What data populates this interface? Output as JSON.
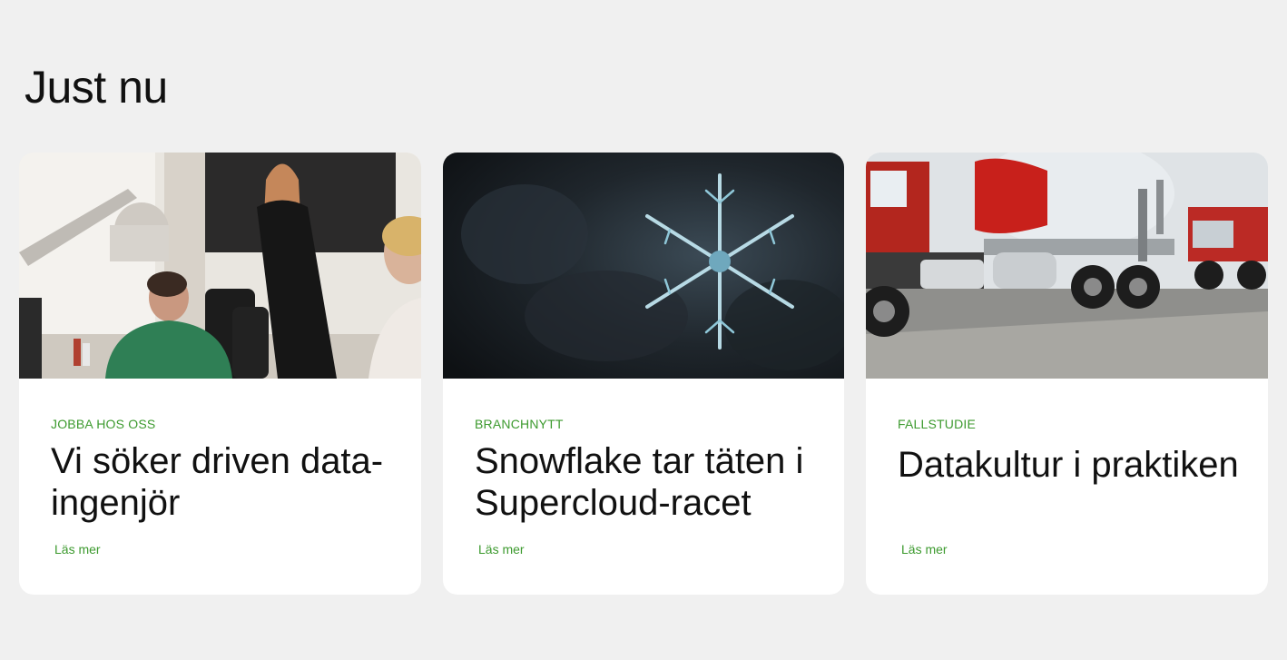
{
  "section": {
    "title": "Just nu"
  },
  "cards": [
    {
      "image": "office-meeting-photo",
      "category": "JOBBA HOS OSS",
      "title": "Vi söker driven data-ingenjör",
      "link_label": "Läs mer"
    },
    {
      "image": "snowflake-photo",
      "category": "BRANCHNYTT",
      "title": "Snowflake tar täten i Supercloud-racet",
      "link_label": "Läs mer"
    },
    {
      "image": "concrete-mixer-trucks-photo",
      "category": "FALLSTUDIE",
      "title": "Datakultur i praktiken",
      "link_label": "Läs mer"
    }
  ],
  "colors": {
    "background": "#f0f0f0",
    "card": "#ffffff",
    "accent": "#3c9a2e",
    "text": "#111111"
  }
}
